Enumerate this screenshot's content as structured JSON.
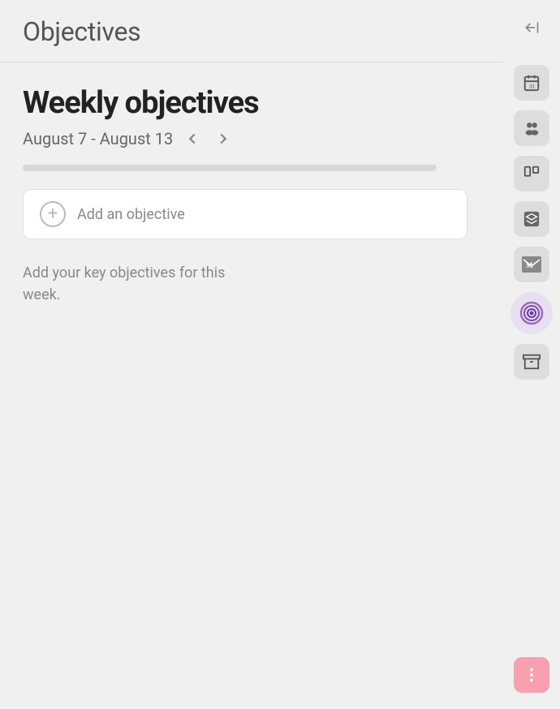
{
  "header": {
    "title": "Objectives",
    "collapse_icon": "→|"
  },
  "weekly": {
    "title": "Weekly objectives",
    "date_range": "August 7 - August 13",
    "progress_percent": 0
  },
  "add_button": {
    "label": "Add an objective"
  },
  "empty_state": {
    "text": "Add your key objectives for this week."
  },
  "sidebar": {
    "icons": [
      {
        "name": "calendar-icon",
        "label": "Calendar"
      },
      {
        "name": "people-icon",
        "label": "People"
      },
      {
        "name": "board-icon",
        "label": "Board"
      },
      {
        "name": "layers-icon",
        "label": "Layers"
      },
      {
        "name": "gmail-icon",
        "label": "Gmail"
      },
      {
        "name": "objectives-icon",
        "label": "Objectives",
        "active": true
      },
      {
        "name": "archive-icon",
        "label": "Archive"
      },
      {
        "name": "more-icon",
        "label": "More"
      }
    ]
  }
}
